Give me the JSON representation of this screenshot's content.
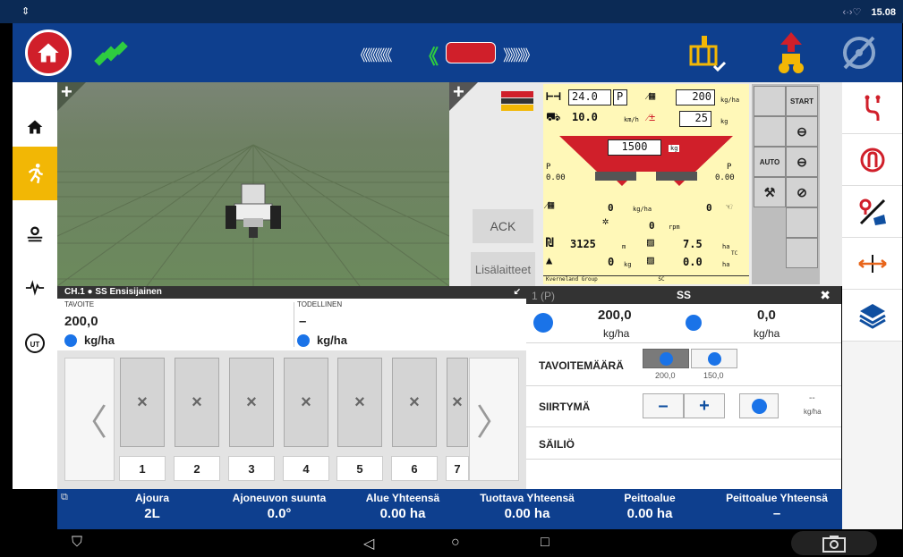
{
  "status_bar": {
    "usb_icon": "usb-icon",
    "time": "15.08",
    "signal": "‹·›♡"
  },
  "top_bar": {
    "home_icon": "home-icon",
    "gps_icon": "satellite-icon",
    "guidance_left": "《《《《《《",
    "guidance_right": "》》》》》",
    "implement_icon": "implement-status-icon",
    "tractor_icon": "tractor-lift-icon",
    "steering_icon": "steering-disabled-icon",
    "colors": {
      "accent_red": "#d01f2a",
      "green": "#2ecc40",
      "yellow": "#f2b705"
    }
  },
  "left_sidebar": [
    "home-icon",
    "runner-icon",
    "settings-field-icon",
    "pulse-icon",
    "ut-icon"
  ],
  "right_sidebar": [
    "guidance-lines-icon",
    "headland-turn-icon",
    "map-boundary-icon",
    "offset-icon",
    "layers-icon"
  ],
  "map": {
    "add_button": "+"
  },
  "terminal": {
    "add_button": "+",
    "ack_label": "ACK",
    "lisalaitteet_label": "Lisälaitteet",
    "working_width": "24.0",
    "p_label": "P",
    "rate_target": "200",
    "rate_unit": "kg/ha",
    "speed": "10.0",
    "speed_unit": "km/h",
    "rate_step": "25",
    "rate_step_unit": "kg",
    "hopper": "1500",
    "hopper_unit": "kg",
    "p_left_value": "0.00",
    "p_right_value": "0.00",
    "app_rate": "0",
    "app_rate_unit": "kg/ha",
    "app_rate_right": "0",
    "rpm": "0",
    "rpm_unit": "rpm",
    "area_counter": "3125",
    "area_counter_unit": "m",
    "area_total": "7.5",
    "area_total_unit": "ha",
    "weight_counter": "0",
    "weight_counter_unit": "kg",
    "area_tc": "0.0",
    "area_tc_unit": "ha",
    "tc_label": "TC",
    "footer": "Kverneland Group",
    "footer_sc": "SC",
    "softkeys": {
      "start": "START",
      "auto": "AUTO"
    }
  },
  "channel": {
    "header": "CH.1  ●  SS  Ensisijainen",
    "tavoite_label": "TAVOITE",
    "tavoite_value": "200,0",
    "tavoite_unit": "kg/ha",
    "todellinen_label": "TODELLINEN",
    "todellinen_value": "–",
    "todellinen_unit": "kg/ha"
  },
  "sections": {
    "left_arrow": "〈",
    "right_arrow": "〉",
    "items": [
      {
        "mark": "×",
        "number": "1"
      },
      {
        "mark": "×",
        "number": "2"
      },
      {
        "mark": "×",
        "number": "3"
      },
      {
        "mark": "×",
        "number": "4"
      },
      {
        "mark": "×",
        "number": "5"
      },
      {
        "mark": "×",
        "number": "6"
      },
      {
        "mark": "×",
        "number": "7"
      }
    ]
  },
  "control_panel": {
    "header_left": "1   (P)",
    "header_title": "SS",
    "close": "✖",
    "target_value": "200,0",
    "target_unit": "kg/ha",
    "actual_value": "0,0",
    "actual_unit": "kg/ha",
    "tavoitemaara_label": "TAVOITEMÄÄRÄ",
    "preset1_value": "200,0",
    "preset2_value": "150,0",
    "siirtyma_label": "SIIRTYMÄ",
    "minus": "–",
    "plus": "+",
    "siirtyma_value": "--",
    "siirtyma_unit": "kg/ha",
    "sailio_label": "SÄILIÖ"
  },
  "bottom_bar": [
    {
      "label": "Ajoura",
      "value": "2L"
    },
    {
      "label": "Ajoneuvon suunta",
      "value": "0.0°"
    },
    {
      "label": "Alue Yhteensä",
      "value": "0.00 ha"
    },
    {
      "label": "Tuottava Yhteensä",
      "value": "0.00 ha"
    },
    {
      "label": "Peittoalue",
      "value": "0.00 ha"
    },
    {
      "label": "Peittoalue Yhteensä",
      "value": "–"
    }
  ],
  "nav_bar": {
    "back": "◁",
    "home": "○",
    "recent": "□"
  }
}
